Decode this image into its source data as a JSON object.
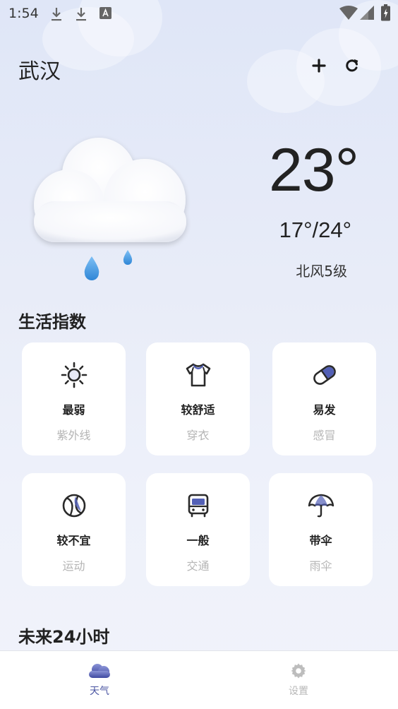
{
  "status_bar": {
    "time": "1:54"
  },
  "header": {
    "city": "武汉",
    "add_icon": "plus-icon",
    "refresh_icon": "refresh-icon"
  },
  "current": {
    "condition_icon": "cloud-rain-icon",
    "temperature": "23°",
    "range": "17°/24°",
    "wind": "北风5级"
  },
  "life_index": {
    "title": "生活指数",
    "items": [
      {
        "value": "最弱",
        "label": "紫外线",
        "icon": "sun-icon"
      },
      {
        "value": "较舒适",
        "label": "穿衣",
        "icon": "shirt-icon"
      },
      {
        "value": "易发",
        "label": "感冒",
        "icon": "pill-icon"
      },
      {
        "value": "较不宜",
        "label": "运动",
        "icon": "ball-icon"
      },
      {
        "value": "一般",
        "label": "交通",
        "icon": "bus-icon"
      },
      {
        "value": "带伞",
        "label": "雨伞",
        "icon": "umbrella-icon"
      }
    ]
  },
  "forecast": {
    "title": "未来24小时"
  },
  "nav": {
    "items": [
      {
        "label": "天气",
        "icon": "cloud-icon",
        "active": true
      },
      {
        "label": "设置",
        "icon": "gear-icon",
        "active": false
      }
    ]
  },
  "colors": {
    "accent": "#4a55a2",
    "inactive": "#b8b8b8",
    "rain": "#3f95e0"
  }
}
